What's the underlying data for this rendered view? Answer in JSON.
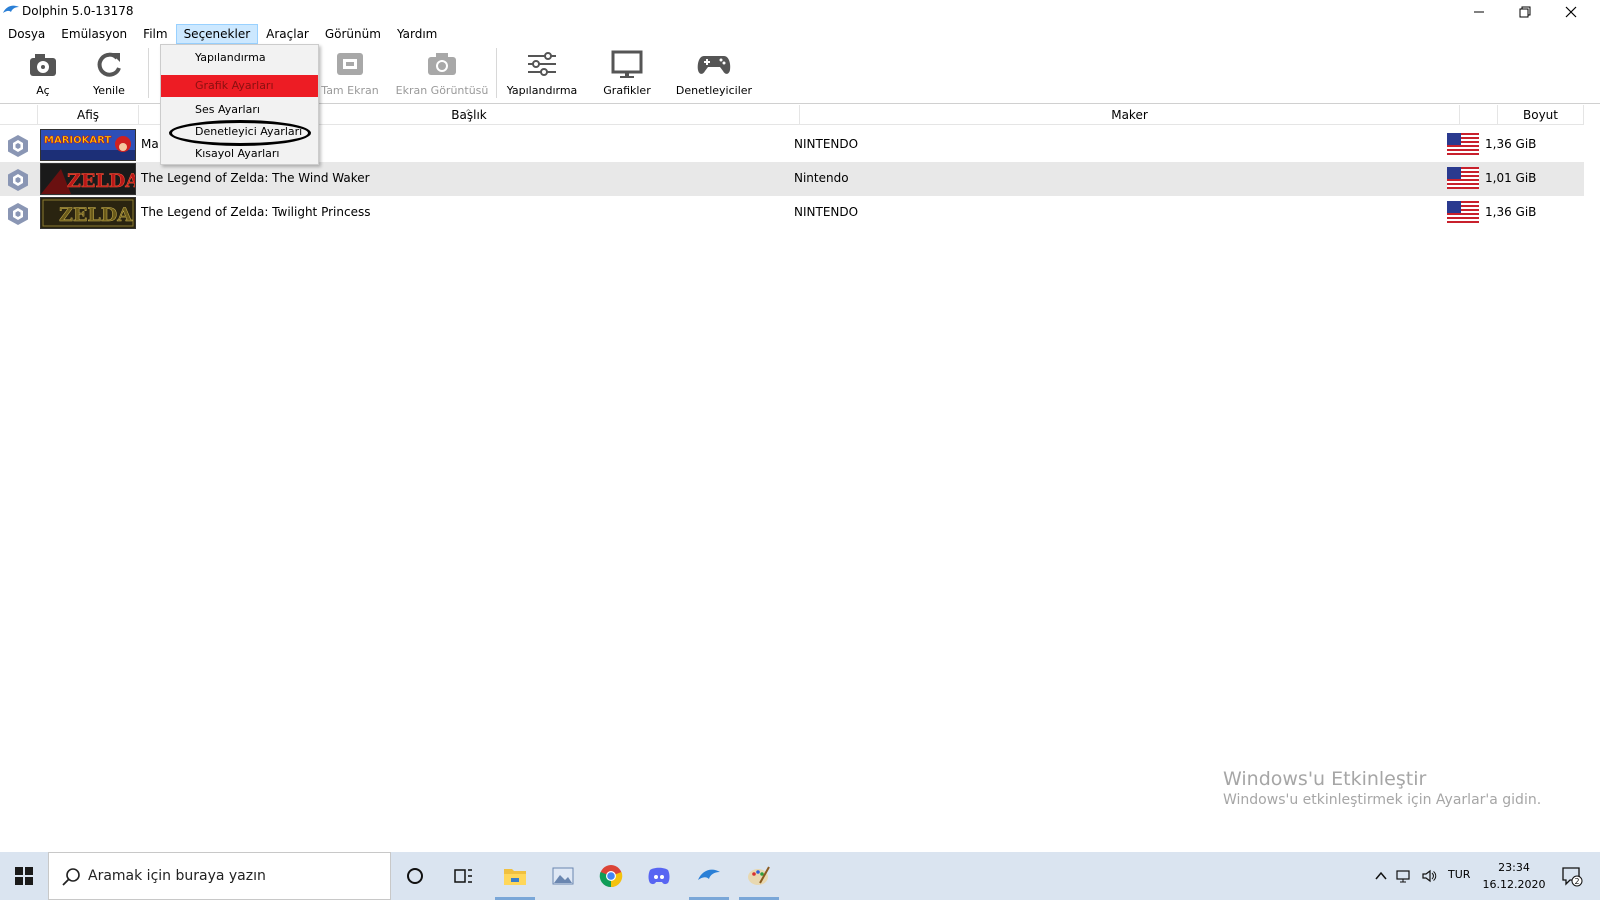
{
  "window": {
    "title": "Dolphin 5.0-13178"
  },
  "menubar": [
    "Dosya",
    "Emülasyon",
    "Film",
    "Seçenekler",
    "Araçlar",
    "Görünüm",
    "Yardım"
  ],
  "toolbar": {
    "open": "Aç",
    "refresh": "Yenile",
    "fullscreen": "Tam Ekran",
    "screenshot": "Ekran Görüntüsü",
    "config": "Yapılandırma",
    "graphics": "Grafikler",
    "controllers": "Denetleyiciler"
  },
  "dropdown": {
    "items": [
      "Yapılandırma",
      "Grafik Ayarları",
      "Ses Ayarları",
      "Denetleyici Ayarları",
      "Kısayol Ayarları"
    ],
    "highlighted_index": 1,
    "highlight_color": "#ed1c24"
  },
  "columns": {
    "banner": "Afiş",
    "title": "Başlık",
    "maker": "Maker",
    "size": "Boyut"
  },
  "games": [
    {
      "banner": "MARIO KART",
      "title": "Mario Kart: Double Dash!!",
      "title_visible": "Ma",
      "maker": "NINTENDO",
      "region": "USA",
      "size": "1,36 GiB"
    },
    {
      "banner": "ZELDA",
      "title": "The Legend of Zelda: The Wind Waker",
      "maker": "Nintendo",
      "region": "USA",
      "size": "1,01 GiB"
    },
    {
      "banner": "ZELDA",
      "title": "The Legend of Zelda: Twilight Princess",
      "maker": "NINTENDO",
      "region": "USA",
      "size": "1,36 GiB"
    }
  ],
  "watermark": {
    "line1": "Windows'u Etkinleştir",
    "line2": "Windows'u etkinleştirmek için Ayarlar'a gidin."
  },
  "taskbar": {
    "search_placeholder": "Aramak için buraya yazın",
    "language": "TUR",
    "time": "23:34",
    "date": "16.12.2020",
    "notification_count": "2"
  }
}
